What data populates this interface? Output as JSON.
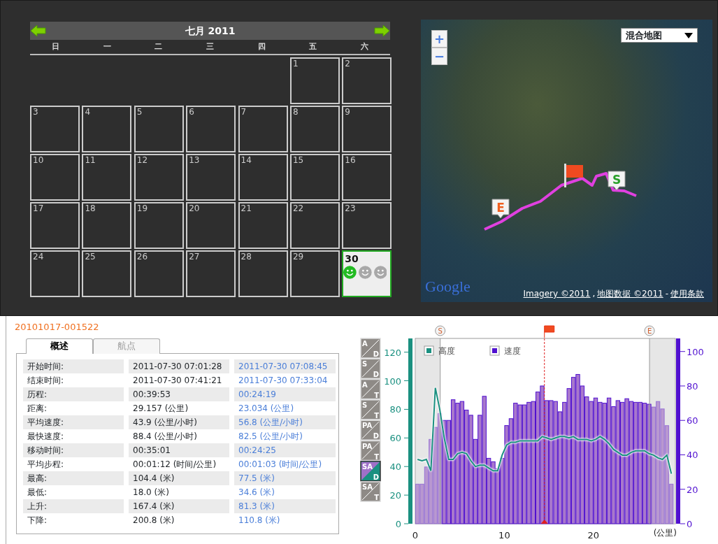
{
  "calendar": {
    "title": "七月 2011",
    "weekdays": [
      "日",
      "一",
      "二",
      "三",
      "四",
      "五",
      "六"
    ],
    "weeks": [
      [
        {
          "kind": "empty"
        },
        {
          "kind": "empty"
        },
        {
          "kind": "empty"
        },
        {
          "kind": "empty"
        },
        {
          "kind": "empty"
        },
        {
          "kind": "day",
          "day": "1",
          "selected": false
        },
        {
          "kind": "day",
          "day": "2",
          "selected": false
        }
      ],
      [
        {
          "kind": "day",
          "day": "3",
          "selected": false
        },
        {
          "kind": "day",
          "day": "4",
          "selected": false
        },
        {
          "kind": "day",
          "day": "5",
          "selected": false
        },
        {
          "kind": "day",
          "day": "6",
          "selected": false
        },
        {
          "kind": "day",
          "day": "7",
          "selected": false
        },
        {
          "kind": "day",
          "day": "8",
          "selected": false
        },
        {
          "kind": "day",
          "day": "9",
          "selected": false
        }
      ],
      [
        {
          "kind": "day",
          "day": "10",
          "selected": false
        },
        {
          "kind": "day",
          "day": "11",
          "selected": false
        },
        {
          "kind": "day",
          "day": "12",
          "selected": false
        },
        {
          "kind": "day",
          "day": "13",
          "selected": false
        },
        {
          "kind": "day",
          "day": "14",
          "selected": false
        },
        {
          "kind": "day",
          "day": "15",
          "selected": false
        },
        {
          "kind": "day",
          "day": "16",
          "selected": false
        }
      ],
      [
        {
          "kind": "day",
          "day": "17",
          "selected": false
        },
        {
          "kind": "day",
          "day": "18",
          "selected": false
        },
        {
          "kind": "day",
          "day": "19",
          "selected": false
        },
        {
          "kind": "day",
          "day": "20",
          "selected": false
        },
        {
          "kind": "day",
          "day": "21",
          "selected": false
        },
        {
          "kind": "day",
          "day": "22",
          "selected": false
        },
        {
          "kind": "day",
          "day": "23",
          "selected": false
        }
      ],
      [
        {
          "kind": "day",
          "day": "24",
          "selected": false
        },
        {
          "kind": "day",
          "day": "25",
          "selected": false
        },
        {
          "kind": "day",
          "day": "26",
          "selected": false
        },
        {
          "kind": "day",
          "day": "27",
          "selected": false
        },
        {
          "kind": "day",
          "day": "28",
          "selected": false
        },
        {
          "kind": "day",
          "day": "29",
          "selected": false
        },
        {
          "kind": "day",
          "day": "30",
          "selected": true,
          "smileys": [
            {
              "on": true
            },
            {
              "on": false
            },
            {
              "on": false
            }
          ]
        }
      ]
    ]
  },
  "map": {
    "map_type": "混合地图",
    "zoom_in": "+",
    "zoom_out": "−",
    "logo": "Google",
    "markers": [
      {
        "kind": "start",
        "label": "S"
      },
      {
        "kind": "end",
        "label": "E"
      },
      {
        "kind": "flag"
      }
    ],
    "attribution": [
      {
        "text": "Imagery ©2011",
        "link": true
      },
      {
        "text": ",",
        "link": false
      },
      {
        "text": "地图数据 ©2011",
        "link": true
      },
      {
        "text": "-",
        "link": false
      },
      {
        "text": "使用条款",
        "link": true
      }
    ]
  },
  "track": {
    "title": "20101017-001522",
    "tabs": [
      {
        "label": "概述",
        "selected": true
      },
      {
        "label": "航点",
        "selected": false
      }
    ],
    "stats": [
      {
        "label": "开始时间:",
        "value": "2011-07-30 07:01:28",
        "compare": "2011-07-30 07:08:45"
      },
      {
        "label": "结束时间:",
        "value": "2011-07-30 07:41:21",
        "compare": "2011-07-30 07:33:04"
      },
      {
        "label": "历程:",
        "value": "00:39:53",
        "compare": "00:24:19"
      },
      {
        "label": "距离:",
        "value": "29.157 (公里)",
        "compare": "23.034 (公里)"
      },
      {
        "label": "平均速度:",
        "value": "43.9 (公里/小时)",
        "compare": "56.8 (公里/小时)"
      },
      {
        "label": "最快速度:",
        "value": "88.4 (公里/小时)",
        "compare": "82.5 (公里/小时)"
      },
      {
        "label": "移动时间:",
        "value": "00:35:01",
        "compare": "00:24:25"
      },
      {
        "label": "平均步程:",
        "value": "00:01:12 (时间/公里)",
        "compare": "00:01:03 (时间/公里)"
      },
      {
        "label": "最高:",
        "value": "104.4 (米)",
        "compare": "77.5 (米)"
      },
      {
        "label": "最低:",
        "value": "18.0 (米)",
        "compare": "34.6 (米)"
      },
      {
        "label": "上升:",
        "value": "167.4 (米)",
        "compare": "81.3 (米)"
      },
      {
        "label": "下降:",
        "value": "200.8 (米)",
        "compare": "110.8 (米)"
      }
    ]
  },
  "chart_modes": [
    {
      "top": "A",
      "bottom": "D",
      "selected": false
    },
    {
      "top": "S",
      "bottom": "D",
      "selected": false
    },
    {
      "top": "A",
      "bottom": "T",
      "selected": false
    },
    {
      "top": "S",
      "bottom": "T",
      "selected": false
    },
    {
      "top": "PA",
      "bottom": "D",
      "selected": false
    },
    {
      "top": "PA",
      "bottom": "T",
      "selected": false
    },
    {
      "top": "SA",
      "bottom": "D",
      "selected": true
    },
    {
      "top": "SA",
      "bottom": "T",
      "selected": false
    }
  ],
  "profile": {
    "speed": {
      "chart_data": {
        "type": "bar",
        "xlabel": "(公里)",
        "xlim": [
          0,
          29.2
        ],
        "ylim": [
          0,
          107.6
        ],
        "xticks": [
          0,
          10,
          20
        ],
        "yticks": [
          0,
          20,
          40,
          60,
          80,
          100
        ],
        "x": [
          0.25,
          0.75,
          1.25,
          1.75,
          2.25,
          2.75,
          3.25,
          3.75,
          4.25,
          4.75,
          5.25,
          5.75,
          6.25,
          6.75,
          7.25,
          7.75,
          8.25,
          8.75,
          9.25,
          9.75,
          10.25,
          10.75,
          11.25,
          11.75,
          12.25,
          12.75,
          13.25,
          13.75,
          14.25,
          14.75,
          15.25,
          15.75,
          16.25,
          16.75,
          17.25,
          17.75,
          18.25,
          18.75,
          19.25,
          19.75,
          20.25,
          20.75,
          21.25,
          21.75,
          22.25,
          22.75,
          23.25,
          23.75,
          24.25,
          24.75,
          25.25,
          25.75,
          26.25,
          26.75,
          27.25,
          27.75,
          28.25,
          28.75
        ],
        "series": [
          {
            "name": "速度",
            "color": "#5010d0",
            "values": [
              23,
              23,
              33,
              49,
              56,
              64,
              60,
              60,
              72,
              70,
              71,
              66,
              63,
              49,
              63,
              74,
              38,
              36,
              32,
              38,
              57,
              61,
              70,
              69,
              69,
              70.5,
              71,
              76.5,
              80,
              71.5,
              71.5,
              71,
              65,
              70.5,
              78.5,
              85,
              86.7,
              80,
              73.7,
              71,
              73,
              70.5,
              70,
              73,
              68,
              71.5,
              70.5,
              72.6,
              71,
              70.5,
              70.5,
              70,
              69.4,
              67.8,
              71,
              66.7,
              57,
              23
            ]
          }
        ],
        "annotations": [
          {
            "text": "S",
            "x": 2.8
          },
          {
            "text": "E",
            "x": 26.3
          }
        ],
        "bands": [
          {
            "axis": "x",
            "from": 0,
            "to": 2.8
          },
          {
            "axis": "x",
            "from": 26.3,
            "to": 29.2
          }
        ],
        "ref_lines": [
          {
            "axis": "x",
            "value": 14.5
          }
        ]
      }
    },
    "altitude": {
      "chart_data": {
        "type": "line",
        "xlim": [
          0,
          29.2
        ],
        "ylim": [
          0,
          129.6
        ],
        "yticks": [
          0,
          20,
          40,
          60,
          80,
          100,
          120
        ],
        "x": [
          0.25,
          0.75,
          1.25,
          1.75,
          2.25,
          2.75,
          3.25,
          3.75,
          4.25,
          4.75,
          5.25,
          5.75,
          6.25,
          6.75,
          7.25,
          7.75,
          8.25,
          8.75,
          9.25,
          9.75,
          10.25,
          10.75,
          11.25,
          11.75,
          12.25,
          12.75,
          13.25,
          13.75,
          14.25,
          14.75,
          15.25,
          15.75,
          16.25,
          16.75,
          17.25,
          17.75,
          18.25,
          18.75,
          19.25,
          19.75,
          20.25,
          20.75,
          21.25,
          21.75,
          22.25,
          22.75,
          23.25,
          23.75,
          24.25,
          24.75,
          25.25,
          25.75,
          26.25,
          26.75,
          27.25,
          27.75,
          28.25,
          28.75
        ],
        "series": [
          {
            "name": "高度",
            "color": "#1a9080",
            "values": [
              45,
              44,
              45,
              37,
              95,
              80,
              60,
              45,
              45,
              49,
              50,
              49,
              44,
              40,
              41,
              41,
              39,
              37,
              37,
              48,
              55,
              57,
              57,
              58,
              58,
              58,
              58,
              58,
              61,
              60,
              59,
              60,
              61,
              61,
              60,
              61,
              59,
              59,
              59,
              58,
              59,
              61,
              59,
              56,
              52,
              50,
              48,
              48,
              50,
              51,
              51,
              51,
              49,
              48,
              46,
              45,
              48,
              35
            ]
          }
        ]
      }
    }
  }
}
